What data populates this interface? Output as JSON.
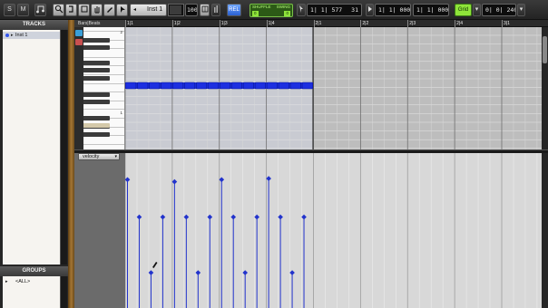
{
  "toolbar": {
    "mode_buttons": [
      "S",
      "M"
    ],
    "track_selector": "Inst 1",
    "velocity_value": "100",
    "velocity_fraction": 0.79,
    "tool_chip": "REL",
    "shuffle": {
      "label_shuffle": "SHUFFLE",
      "label_swing": "SWING",
      "value1": "0",
      "value2": "0"
    },
    "main_counter": "1| 1| 577",
    "counter_tail": "31",
    "start_counter": "1| 1| 000",
    "end_counter": "1| 1| 000",
    "grid_chip": "Grid",
    "nudge_counter": "0| 0| 240"
  },
  "panels": {
    "tracks_title": "TRACKS",
    "track_name": "Inst 1",
    "groups_title": "GROUPS",
    "group_name": "<ALL>"
  },
  "ruler": {
    "label": "Bars|Beats",
    "ticks": [
      "1|1",
      "1|2",
      "1|3",
      "1|4",
      "2|1",
      "2|2",
      "2|3",
      "2|4",
      "3|1"
    ]
  },
  "piano": {
    "octave_labels": [
      "2",
      "1"
    ]
  },
  "velocity_lane": {
    "label": "velocity",
    "values": [
      120,
      85,
      33,
      85,
      118,
      85,
      33,
      85,
      120,
      85,
      33,
      85,
      121,
      85,
      33,
      85
    ]
  },
  "colors": {
    "note": "#1d2fe0",
    "velocity_stem": "#2233cc",
    "accent_green": "#8fe43a"
  }
}
